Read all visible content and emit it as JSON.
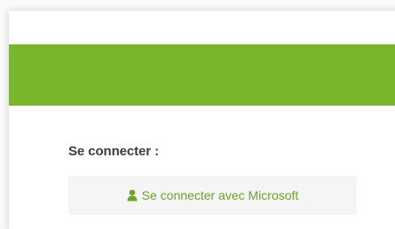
{
  "login": {
    "label": "Se connecter :",
    "microsoft_button": "Se connecter avec Microsoft",
    "button_icon": "user-icon"
  },
  "colors": {
    "header_green": "#78b72c",
    "link_green": "#6aa524",
    "button_bg": "#f5f5f5",
    "label_text": "#3d3d3d"
  }
}
